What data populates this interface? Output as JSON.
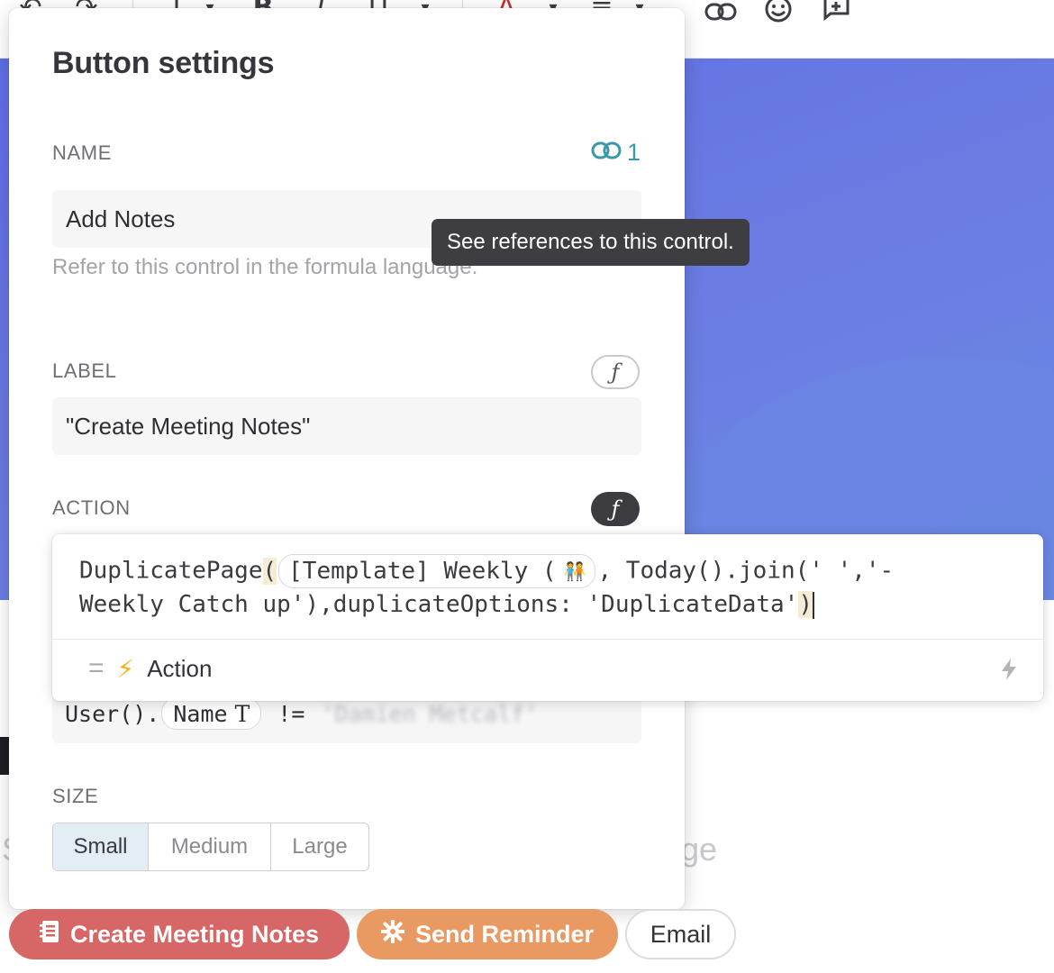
{
  "toolbar": {
    "icons": [
      "undo-icon",
      "redo-icon",
      "heading-icon",
      "bold-icon",
      "italic-icon",
      "underline-icon",
      "text-color-icon",
      "align-icon",
      "link-icon",
      "emoji-icon",
      "add-comment-icon"
    ]
  },
  "panel": {
    "title": "Button settings",
    "name": {
      "label": "NAME",
      "reference_count": "1",
      "value": "Add Notes",
      "hint": "Refer to this control in the formula language."
    },
    "label": {
      "label": "LABEL",
      "value": "\"Create Meeting Notes\""
    },
    "action": {
      "label": "ACTION"
    },
    "visible_formula": {
      "prefix": "User().",
      "chip": "Name",
      "chip_type_icon": "T",
      "operator": "!=",
      "blurred_value": "'Damien Metcalf'"
    },
    "size": {
      "label": "SIZE",
      "options": [
        "Small",
        "Medium",
        "Large"
      ],
      "selected": "Small"
    }
  },
  "editor": {
    "code_func": "DuplicatePage",
    "code_open": "(",
    "code_chip": "[Template] Weekly (",
    "code_chip_emoji": "🧑‍🤝‍🧑",
    "code_after_chip": ", Today().join(' ','-",
    "code_line2": "Weekly Catch up'),duplicateOptions: 'DuplicateData'",
    "code_close": ")",
    "result_label": "Action"
  },
  "tooltip": {
    "text": "See references to this control."
  },
  "background": {
    "partial_text": "ge",
    "partial_left_char": "S"
  },
  "buttons": [
    {
      "label": "Create Meeting Notes",
      "icon": "notebook-icon",
      "color": "#d66766"
    },
    {
      "label": "Send Reminder",
      "icon": "hashtag-icon",
      "color": "#e99a63"
    },
    {
      "label": "Email",
      "icon": "",
      "color": "#ffffff"
    }
  ],
  "colors": {
    "accent_teal": "#3a98a8",
    "hero_blue": "#6b7de2",
    "selected_size": "#e3eef4"
  }
}
